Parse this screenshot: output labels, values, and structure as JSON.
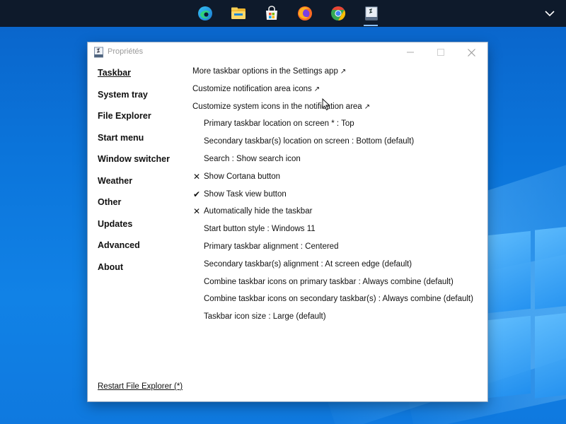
{
  "taskbar": {
    "icons": [
      {
        "name": "edge-icon",
        "color": "#1fa3d9"
      },
      {
        "name": "file-explorer-icon",
        "color": "#f5c542"
      },
      {
        "name": "microsoft-store-icon",
        "color": "#ffffff"
      },
      {
        "name": "firefox-icon",
        "color": "#ff7a1a"
      },
      {
        "name": "chrome-icon",
        "color": "#34a853"
      },
      {
        "name": "properties-app-icon",
        "color": "#dfe7f1"
      }
    ],
    "active_index": 5,
    "overflow_icon": "chevron-down-icon"
  },
  "dialog": {
    "title": "Propriétés",
    "sidebar": [
      {
        "label": "Taskbar",
        "selected": true
      },
      {
        "label": "System tray"
      },
      {
        "label": "File Explorer"
      },
      {
        "label": "Start menu"
      },
      {
        "label": "Window switcher"
      },
      {
        "label": "Weather"
      },
      {
        "label": "Other"
      },
      {
        "label": "Updates"
      },
      {
        "label": "Advanced"
      },
      {
        "label": "About"
      }
    ],
    "restart_label": "Restart File Explorer (*)",
    "options": [
      {
        "mark": "",
        "text": "More taskbar options in the Settings app",
        "external": true
      },
      {
        "mark": "",
        "text": "Customize notification area icons",
        "external": true
      },
      {
        "mark": "",
        "text": "Customize system icons in the notification area",
        "external": true
      },
      {
        "mark": "",
        "text": "Primary taskbar location on screen * : Top"
      },
      {
        "mark": "",
        "text": "Secondary taskbar(s) location on screen : Bottom (default)"
      },
      {
        "mark": "",
        "text": "Search : Show search icon"
      },
      {
        "mark": "✕",
        "text": "Show Cortana button"
      },
      {
        "mark": "✔",
        "text": "Show Task view button"
      },
      {
        "mark": "✕",
        "text": "Automatically hide the taskbar"
      },
      {
        "mark": "",
        "text": "Start button style : Windows 11"
      },
      {
        "mark": "",
        "text": "Primary taskbar alignment : Centered"
      },
      {
        "mark": "",
        "text": "Secondary taskbar(s) alignment : At screen edge (default)"
      },
      {
        "mark": "",
        "text": "Combine taskbar icons on primary taskbar : Always combine (default)"
      },
      {
        "mark": "",
        "text": "Combine taskbar icons on secondary taskbar(s) : Always combine (default)"
      },
      {
        "mark": "",
        "text": "Taskbar icon size : Large (default)"
      }
    ],
    "external_glyph": "↗"
  }
}
